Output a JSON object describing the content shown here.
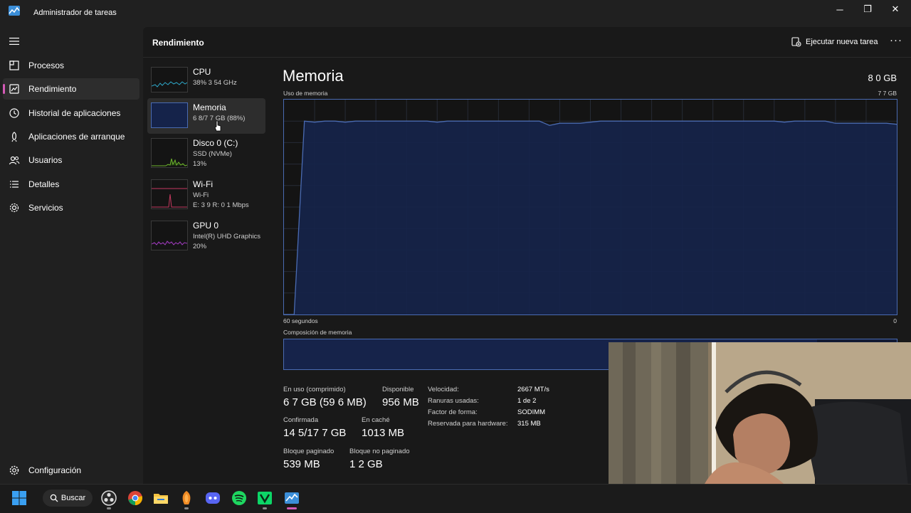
{
  "window": {
    "title": "Administrador de tareas",
    "controls": {
      "minimize": "─",
      "restore": "❐",
      "close": "✕"
    }
  },
  "nav": {
    "items": [
      {
        "label": "Procesos",
        "icon": "processes-icon"
      },
      {
        "label": "Rendimiento",
        "icon": "performance-icon",
        "active": true
      },
      {
        "label": "Historial de aplicaciones",
        "icon": "history-icon"
      },
      {
        "label": "Aplicaciones de arranque",
        "icon": "startup-icon"
      },
      {
        "label": "Usuarios",
        "icon": "users-icon"
      },
      {
        "label": "Detalles",
        "icon": "details-icon"
      },
      {
        "label": "Servicios",
        "icon": "services-icon"
      }
    ],
    "settings_label": "Configuración"
  },
  "header": {
    "title": "Rendimiento",
    "run_task_label": "Ejecutar nueva tarea",
    "more_label": "···"
  },
  "resources": [
    {
      "name": "CPU",
      "sub1": "38% 3 54 GHz",
      "sub2": ""
    },
    {
      "name": "Memoria",
      "sub1": "6 8/7 7 GB (88%)",
      "sub2": ""
    },
    {
      "name": "Disco 0 (C:)",
      "sub1": "SSD (NVMe)",
      "sub2": "13%"
    },
    {
      "name": "Wi-Fi",
      "sub1": "Wi-Fi",
      "sub2": "E: 3 9 R: 0 1 Mbps"
    },
    {
      "name": "GPU 0",
      "sub1": "Intel(R) UHD Graphics",
      "sub2": "20%"
    }
  ],
  "memory": {
    "title": "Memoria",
    "total": "8 0 GB",
    "usage_label": "Uso de memoria",
    "usage_max": "7 7 GB",
    "time_left": "60 segundos",
    "time_right": "0",
    "composition_label": "Composición de memoria",
    "composition_in_use_fraction": 0.87,
    "usage_history_fraction": [
      0,
      0,
      0.9,
      0.895,
      0.9,
      0.9,
      0.895,
      0.9,
      0.9,
      0.9,
      0.9,
      0.9,
      0.9,
      0.9,
      0.9,
      0.895,
      0.9,
      0.9,
      0.9,
      0.9,
      0.9,
      0.9,
      0.9,
      0.9,
      0.9,
      0.9,
      0.88,
      0.89,
      0.89,
      0.89,
      0.895,
      0.9,
      0.9,
      0.9,
      0.9,
      0.9,
      0.9,
      0.9,
      0.9,
      0.9,
      0.9,
      0.9,
      0.9,
      0.9,
      0.9,
      0.9,
      0.9,
      0.9,
      0.9,
      0.895,
      0.9,
      0.9,
      0.9,
      0.9,
      0.89,
      0.89,
      0.89,
      0.89,
      0.89,
      0.89,
      0.885
    ],
    "stats": {
      "in_use_label": "En uso (comprimido)",
      "in_use_value": "6 7 GB (59 6 MB)",
      "available_label": "Disponible",
      "available_value": "956 MB",
      "committed_label": "Confirmada",
      "committed_value": "14 5/17 7 GB",
      "cached_label": "En caché",
      "cached_value": "1013 MB",
      "paged_pool_label": "Bloque paginado",
      "paged_pool_value": "539 MB",
      "nonpaged_pool_label": "Bloque no paginado",
      "nonpaged_pool_value": "1 2 GB"
    },
    "details": [
      {
        "key": "Velocidad:",
        "value": "2667 MT/s"
      },
      {
        "key": "Ranuras usadas:",
        "value": "1 de 2"
      },
      {
        "key": "Factor de forma:",
        "value": "SODIMM"
      },
      {
        "key": "Reservada para hardware:",
        "value": "315 MB"
      }
    ]
  },
  "taskbar": {
    "search_label": "Buscar",
    "apps": [
      "windows-start-icon",
      "obs-icon",
      "chrome-icon",
      "file-explorer-icon",
      "fl-studio-icon",
      "discord-icon",
      "spotify-icon",
      "green-app-icon",
      "task-manager-icon"
    ]
  },
  "colors": {
    "accent": "#d45ab6",
    "memory_line": "#4a6bb2",
    "memory_fill": "#15234a",
    "cpu": "#2fa8c9",
    "disk": "#6fb52e",
    "wifi": "#c5395f",
    "gpu": "#a23fbf"
  }
}
